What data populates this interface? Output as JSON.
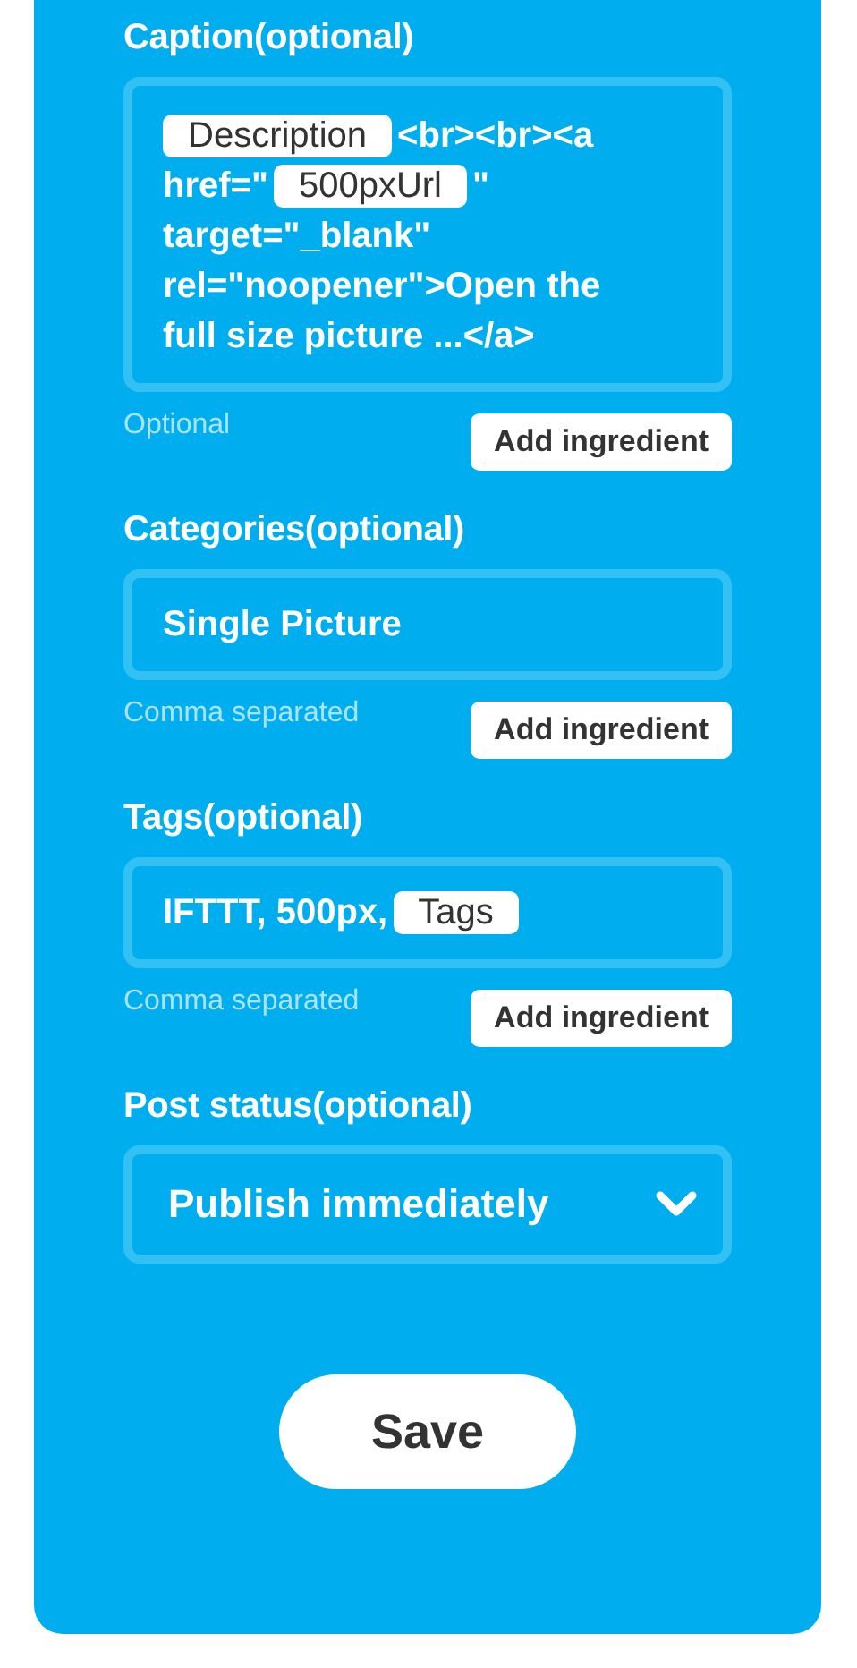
{
  "fields": [
    {
      "kind": "text",
      "label": "Caption(optional)",
      "multiline": true,
      "lines": [
        [
          {
            "kind": "ingredient",
            "text": "Description"
          },
          {
            "kind": "text",
            "text": "<br><br><a"
          }
        ],
        [
          {
            "kind": "text",
            "text": "href=\""
          },
          {
            "kind": "ingredient",
            "text": "500pxUrl"
          },
          {
            "kind": "text",
            "text": "\""
          }
        ],
        [
          {
            "kind": "text",
            "text": "target=\"_blank\""
          }
        ],
        [
          {
            "kind": "text",
            "text": "rel=\"noopener\">Open the"
          }
        ],
        [
          {
            "kind": "text",
            "text": "full size picture ...</a>"
          }
        ]
      ],
      "hint": "Optional",
      "button": "Add ingredient"
    },
    {
      "kind": "text",
      "label": "Categories(optional)",
      "multiline": false,
      "lines": [
        [
          {
            "kind": "text",
            "text": "Single Picture"
          }
        ]
      ],
      "hint": "Comma separated",
      "button": "Add ingredient"
    },
    {
      "kind": "text",
      "label": "Tags(optional)",
      "multiline": false,
      "lines": [
        [
          {
            "kind": "text",
            "text": "IFTTT, 500px,"
          },
          {
            "kind": "ingredient",
            "text": "Tags"
          }
        ]
      ],
      "hint": "Comma separated",
      "button": "Add ingredient"
    },
    {
      "kind": "select",
      "label": "Post status(optional)",
      "value": "Publish immediately"
    }
  ],
  "save_button": "Save"
}
